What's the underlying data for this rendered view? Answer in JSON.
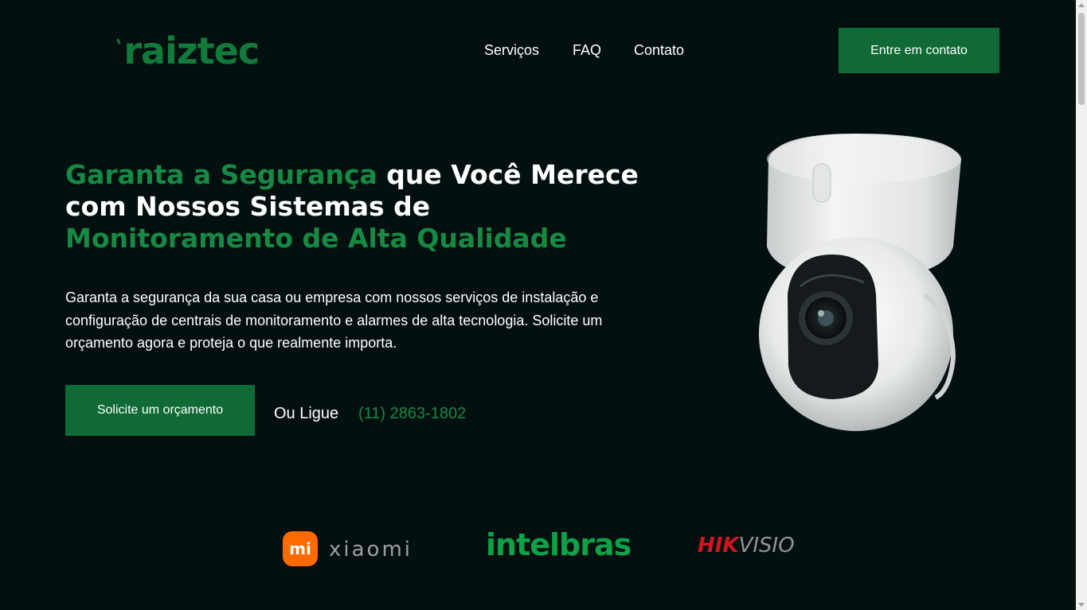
{
  "header": {
    "logo_text": "raiztec",
    "logo_color": "#127a3b",
    "nav": [
      {
        "label": "Serviços"
      },
      {
        "label": "FAQ"
      },
      {
        "label": "Contato"
      }
    ],
    "cta_label": "Entre em contato"
  },
  "hero": {
    "headline_part1": "Garanta a Segurança",
    "headline_part2": " que Você Merece com Nossos Sistemas de ",
    "headline_part3": "Monitoramento de Alta Qualidade",
    "paragraph": "Garanta a segurança da sua casa ou empresa com nossos serviços de instalação e configuração de centrais de monitoramento e alarmes de alta tecnologia. Solicite um orçamento agora e proteja o que realmente importa.",
    "quote_button": "Solicite um orçamento",
    "or_call": "Ou Ligue",
    "phone": "(11) 2863-1802",
    "accent_color": "#168a43",
    "image": "security-camera-image"
  },
  "brands": [
    {
      "name": "xiaomi",
      "badge": "mi",
      "text": "xiaomi"
    },
    {
      "name": "intelbras",
      "text": "intelbras"
    },
    {
      "name": "hikvision",
      "text_red": "HIK",
      "text_gray": "VISIO"
    }
  ],
  "colors": {
    "background": "#041010",
    "button": "#0f6a36"
  }
}
